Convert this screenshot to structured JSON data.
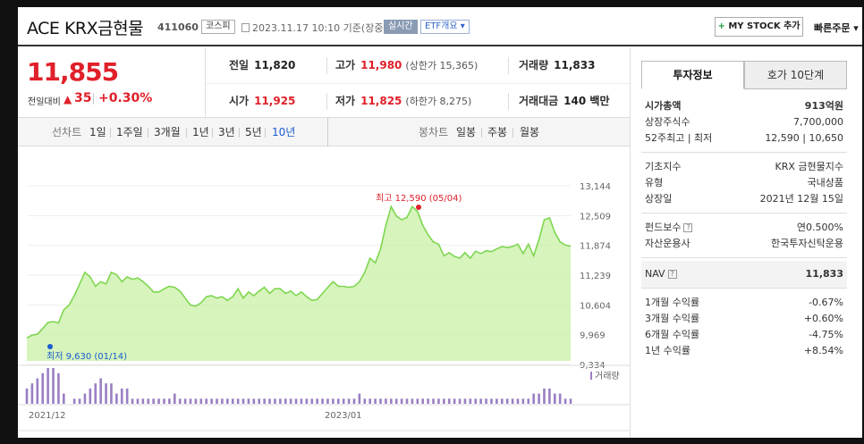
{
  "header": {
    "stock_name": "ACE KRX금현물",
    "stock_code": "411060",
    "market_badge": "코스피",
    "datetime": "2023.11.17 10:10 기준(장중)",
    "realtime_badge": "실시간",
    "etf_badge": "ETF개요 ▾",
    "mystock_label": "MY STOCK 추가",
    "mystock_plus": "+",
    "quick_order": "빠른주문 ▾"
  },
  "price": {
    "current": "11,855",
    "change_label": "전일대비",
    "change_arrow": "▲",
    "change_value": "35",
    "change_pct": "+0.30%"
  },
  "quote": {
    "prev_label": "전일",
    "prev_value": "11,820",
    "high_label": "고가",
    "high_value": "11,980",
    "upper_limit": "(상한가 15,365)",
    "volume_label": "거래량",
    "volume_value": "11,833",
    "open_label": "시가",
    "open_value": "11,925",
    "low_label": "저가",
    "low_value": "11,825",
    "lower_limit": "(하한가 8,275)",
    "amount_label": "거래대금",
    "amount_value": "140 백만"
  },
  "period_bar": {
    "line_label": "선차트",
    "periods": [
      "1일",
      "1주일",
      "3개월",
      "1년",
      "3년",
      "5년",
      "10년"
    ],
    "active": "10년",
    "candle_label": "봉차트",
    "candles": [
      "일봉",
      "주봉",
      "월봉"
    ]
  },
  "tabs": {
    "invest": "투자정보",
    "hoga": "호가 10단계"
  },
  "info": {
    "market_cap_label": "시가총액",
    "market_cap_value": "913억원",
    "listed_label": "상장주식수",
    "listed_value": "7,700,000",
    "w52_label": "52주최고 | 최저",
    "w52_value": "12,590 | 10,650",
    "base_index_label": "기초지수",
    "base_index_value": "KRX 금현물지수",
    "type_label": "유형",
    "type_value": "국내상품",
    "listing_date_label": "상장일",
    "listing_date_value": "2021년 12월 15일",
    "fee_label": "펀드보수",
    "fee_value": "연0.500%",
    "manager_label": "자산운용사",
    "manager_value": "한국투자신탁운용",
    "nav_label": "NAV",
    "nav_value": "11,833",
    "r1m_label": "1개월 수익률",
    "r1m_value": "-0.67%",
    "r3m_label": "3개월 수익률",
    "r3m_value": "+0.60%",
    "r6m_label": "6개월 수익률",
    "r6m_value": "-4.75%",
    "r1y_label": "1년 수익률",
    "r1y_value": "+8.54%",
    "qmark": "?"
  },
  "colors": {
    "up": "#e0202a",
    "down": "#1a5bd0",
    "area_fill": "#c8f0a6",
    "area_line": "#7ed650",
    "volume_bar": "#9a7fc4"
  },
  "chart_data": {
    "type": "area",
    "y_ticks": [
      "13,144",
      "12,509",
      "11,874",
      "11,239",
      "10,604",
      "9,969",
      "9,334"
    ],
    "ylim": [
      9334,
      13144
    ],
    "x_labels": [
      "2021/12",
      "2023/01"
    ],
    "max_annotation": "최고 12,590 (05/04)",
    "min_annotation": "최저 9,630 (01/14)",
    "volume_label": "거래량",
    "series": [
      {
        "values": [
          9900,
          9960,
          9980,
          10100,
          10230,
          10250,
          10220,
          10500,
          10600,
          10800,
          11050,
          11300,
          11200,
          11000,
          11100,
          11050,
          11300,
          11250,
          11100,
          11200,
          11150,
          11180,
          11100,
          11000,
          10880,
          10880,
          10950,
          11000,
          10980,
          10900,
          10750,
          10600,
          10580,
          10650,
          10780,
          10800,
          10750,
          10780,
          10700,
          10780,
          10950,
          10750,
          10880,
          10800,
          10900,
          10980,
          10850,
          10950,
          10950,
          10850,
          10900,
          10800,
          10880,
          10780,
          10700,
          10720,
          10850,
          10980,
          11100,
          11000,
          11000,
          10980,
          11000,
          11100,
          11300,
          11600,
          11500,
          11800,
          12300,
          12700,
          12500,
          12420,
          12470,
          12700,
          12600,
          12300,
          12100,
          11950,
          11900,
          11650,
          11720,
          11640,
          11600,
          11720,
          11600,
          11750,
          11700,
          11760,
          11740,
          11800,
          11850,
          11830,
          11850,
          11900,
          11700,
          11900,
          11650,
          12000,
          12420,
          12460,
          12150,
          11950,
          11880,
          11860
        ],
        "volume": [
          3,
          4,
          5,
          6,
          7,
          7,
          6,
          2,
          0,
          1,
          1,
          2,
          3,
          4,
          5,
          4,
          4,
          2,
          3,
          3,
          1,
          1,
          1,
          1,
          1,
          1,
          1,
          1,
          2,
          1,
          1,
          1,
          1,
          1,
          1,
          1,
          1,
          1,
          1,
          1,
          1,
          1,
          1,
          1,
          1,
          1,
          1,
          1,
          1,
          1,
          1,
          1,
          1,
          1,
          1,
          1,
          1,
          1,
          1,
          1,
          1,
          1,
          1,
          2,
          1,
          1,
          1,
          1,
          1,
          1,
          1,
          1,
          1,
          1,
          1,
          1,
          1,
          1,
          1,
          1,
          1,
          1,
          1,
          1,
          1,
          1,
          1,
          1,
          1,
          1,
          1,
          1,
          1,
          1,
          1,
          1,
          2,
          2,
          3,
          3,
          2,
          2,
          1,
          1
        ]
      }
    ]
  }
}
